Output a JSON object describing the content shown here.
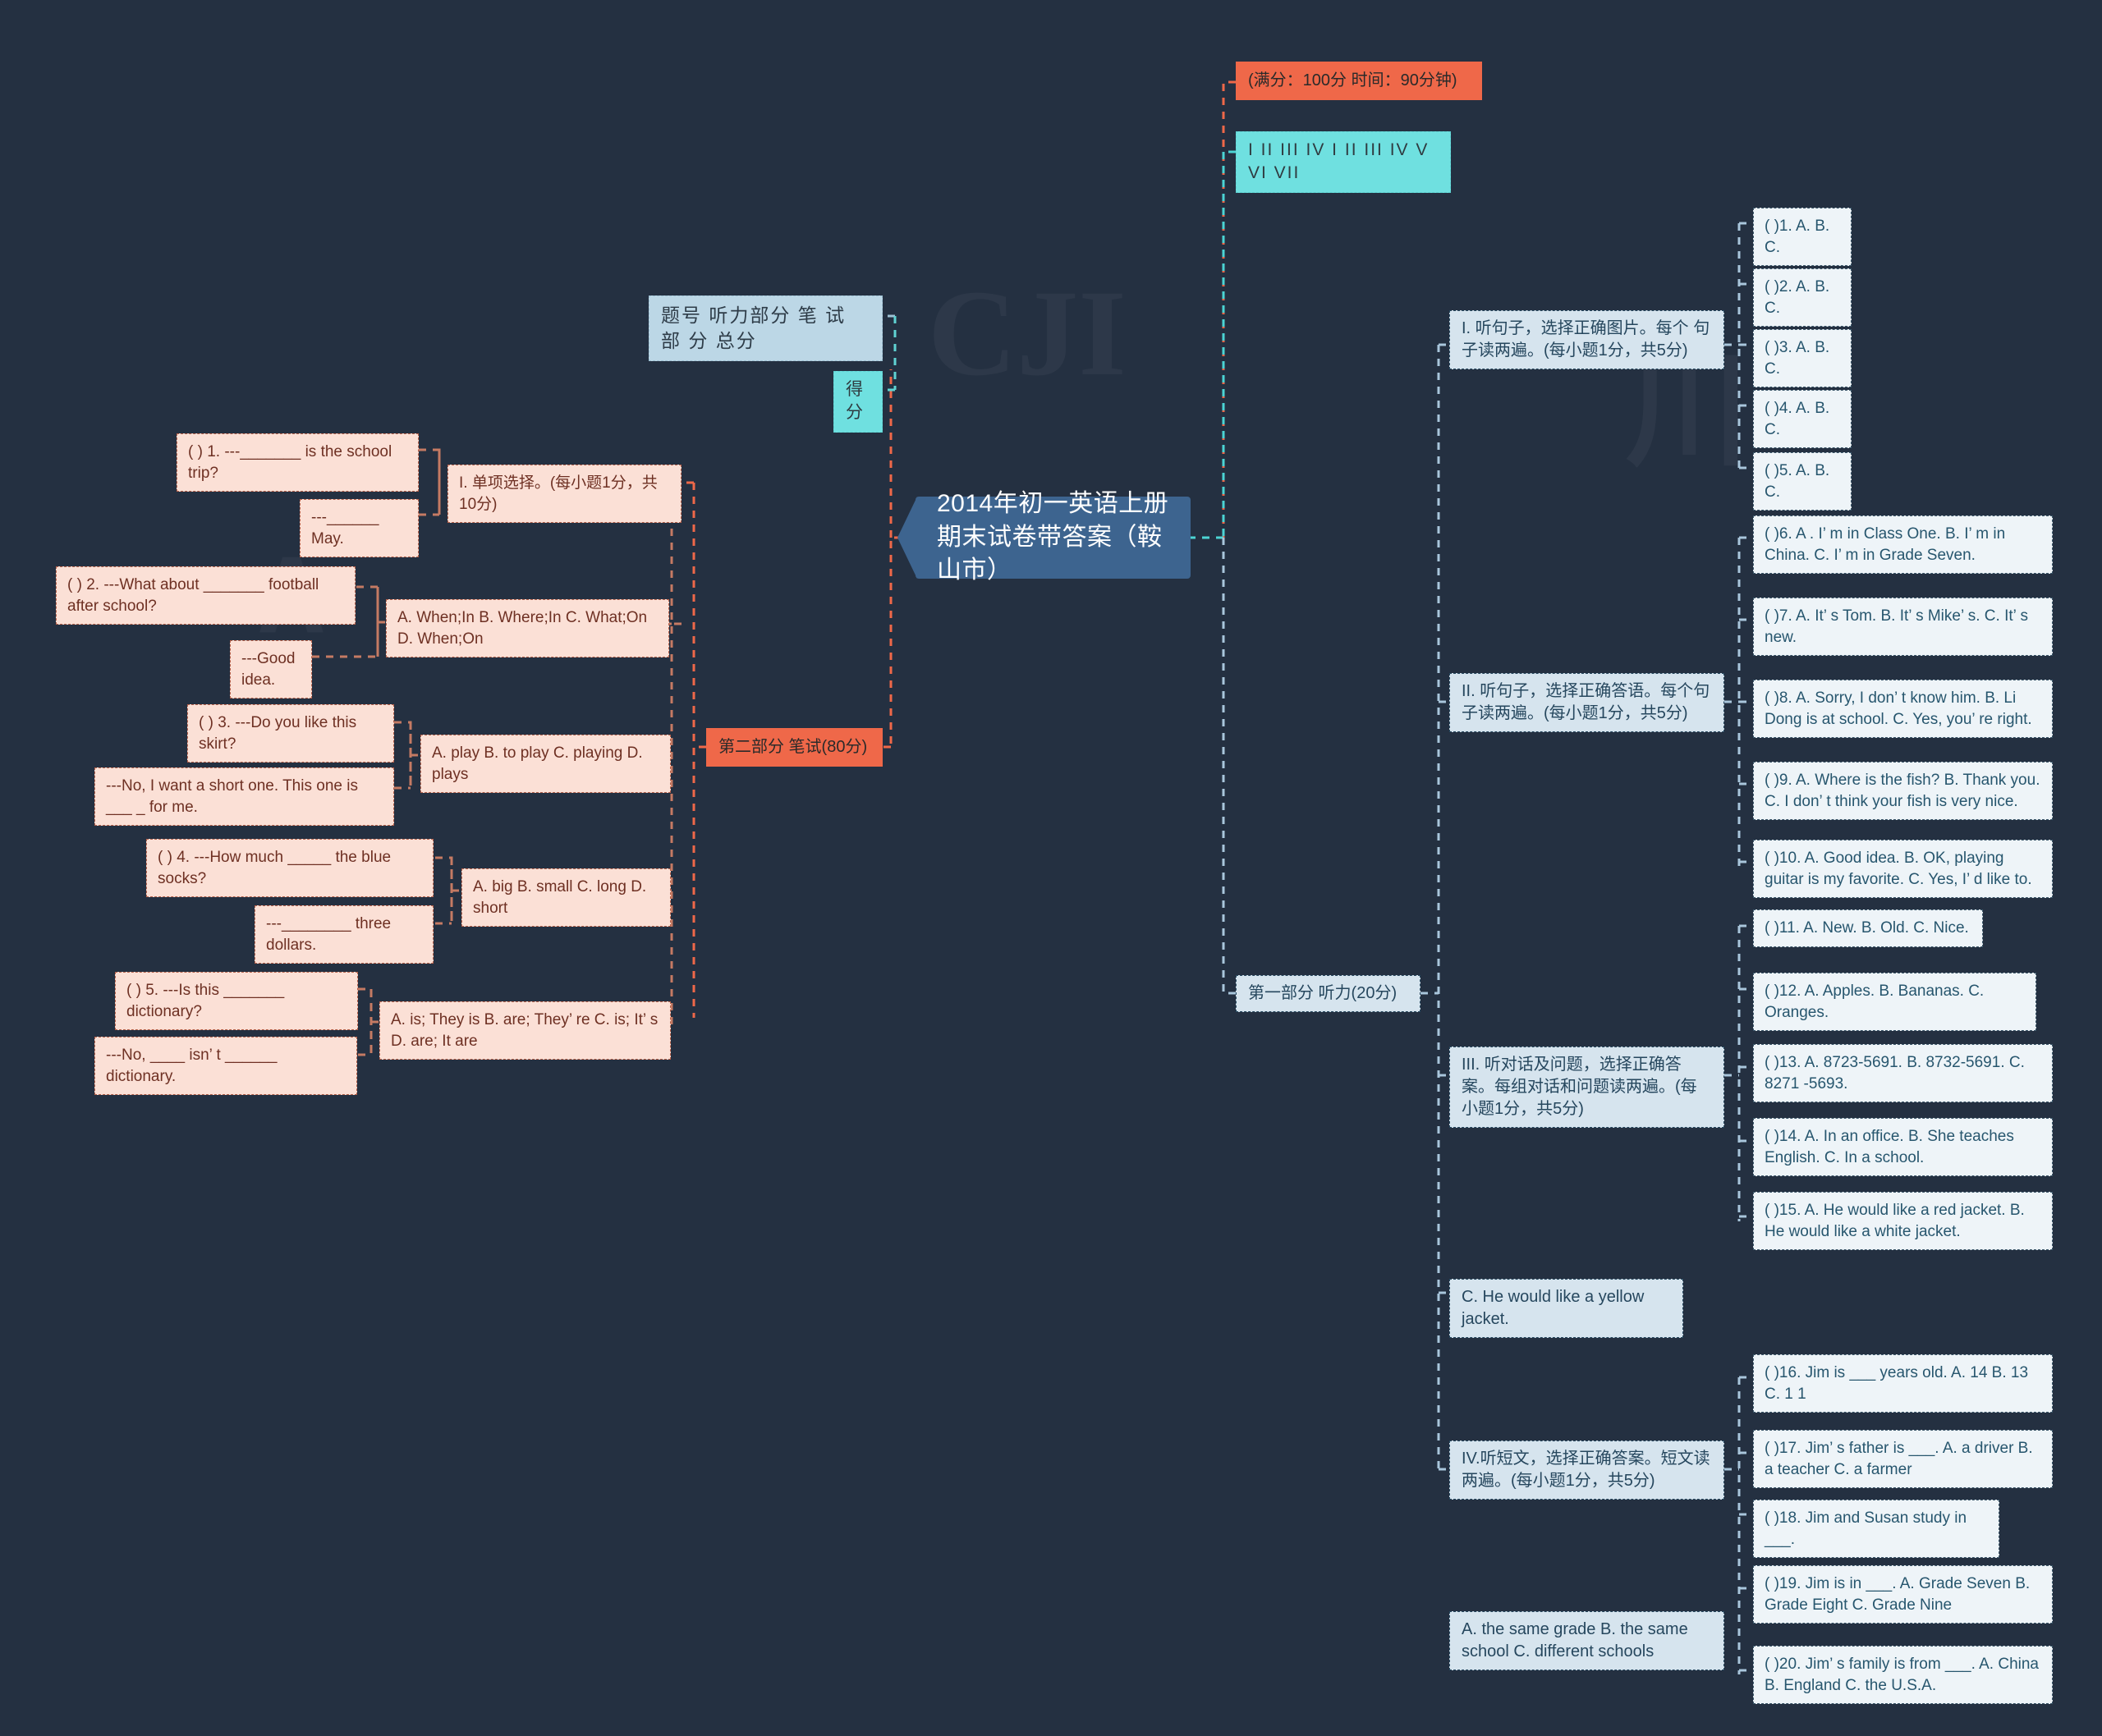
{
  "root": {
    "title": "2014年初一英语上册期末试卷带答案（鞍山市）"
  },
  "top_branch": {
    "score_time": "(满分：100分 时间：90分钟)",
    "roman_row": "I II III IV I II III IV V VI VII",
    "table_header": "题号 听力部分 笔 试 部 分 总分",
    "table_score": "得分"
  },
  "part_one": {
    "label": "第一部分 听力(20分)",
    "sections": [
      {
        "label": "I. 听句子，选择正确图片。每个 句子读两遍。(每小题1分，共5分)",
        "items": [
          "( )1. A. B. C.",
          "( )2. A. B. C.",
          "( )3. A. B. C.",
          "( )4. A. B. C.",
          "( )5. A. B. C."
        ]
      },
      {
        "label": "II. 听句子，选择正确答语。每个句子读两遍。(每小题1分，共5分)",
        "items": [
          "( )6. A . I’ m in Class One. B. I’ m in China. C. I’ m in Grade Seven.",
          "( )7. A. It’ s Tom. B. It’ s Mike’ s. C. It’ s new.",
          "( )8. A. Sorry, I don’ t know him. B. Li Dong is at school. C. Yes, you’ re right.",
          "( )9. A. Where is the fish? B. Thank you. C. I don’ t think your fish is very nice.",
          "( )10. A. Good idea. B. OK, playing guitar is my favorite. C. Yes, I’ d like to."
        ]
      },
      {
        "label": "III. 听对话及问题，选择正确答案。每组对话和问题读两遍。(每小题1分，共5分)",
        "items": [
          "( )11. A. New. B. Old. C. Nice.",
          "( )12. A. Apples. B. Bananas. C. Oranges.",
          "( )13. A. 8723-5691. B. 8732-5691. C. 8271 -5693.",
          "( )14. A. In an office. B. She teaches English. C. In a school.",
          "( )15. A. He would like a red jacket. B. He would like a white jacket."
        ],
        "trailing": "C. He would like a yellow jacket."
      },
      {
        "label": "IV.听短文，选择正确答案。短文读两遍。(每小题1分，共5分)",
        "items": [
          "( )16. Jim is ___ years old. A. 14 B. 13 C. 1 1",
          "( )17. Jim’ s father is ___. A. a driver B. a teacher C. a farmer",
          "( )18. Jim and Susan study in ___.",
          "( )19. Jim is in ___. A. Grade Seven B. Grade Eight C. Grade Nine",
          "( )20. Jim’ s family is from ___. A. China B. England C. the U.S.A."
        ],
        "trailing": "A. the same grade B. the same school C. different schools"
      }
    ]
  },
  "part_two": {
    "label": "第二部分 笔试(80分)",
    "section_label": "I. 单项选择。(每小题1分，共10分)",
    "questions": [
      {
        "stem": "( ) 1. ---_______ is the school trip?",
        "reply": "---______ May.",
        "choices": "A. When;In B. Where;In C. What;On D. When;On"
      },
      {
        "stem": "( ) 2. ---What about _______ football after school?",
        "reply": "---Good idea.",
        "choices": "A. play B. to play C. playing D. plays"
      },
      {
        "stem": "( ) 3. ---Do you like this skirt?",
        "reply": "---No, I want a short one. This one is ___ _ for me.",
        "choices": "A. big B. small C. long D. short"
      },
      {
        "stem": "( ) 4. ---How much _____ the blue socks?",
        "reply": "---________ three dollars.",
        "choices": "A. is; They is B. are; They’ re C. is; It’ s D. are; It are"
      },
      {
        "stem": "( ) 5. ---Is this _______ dictionary?",
        "reply": "---No, ____ isn’ t ______ dictionary.",
        "choices": ""
      }
    ]
  }
}
